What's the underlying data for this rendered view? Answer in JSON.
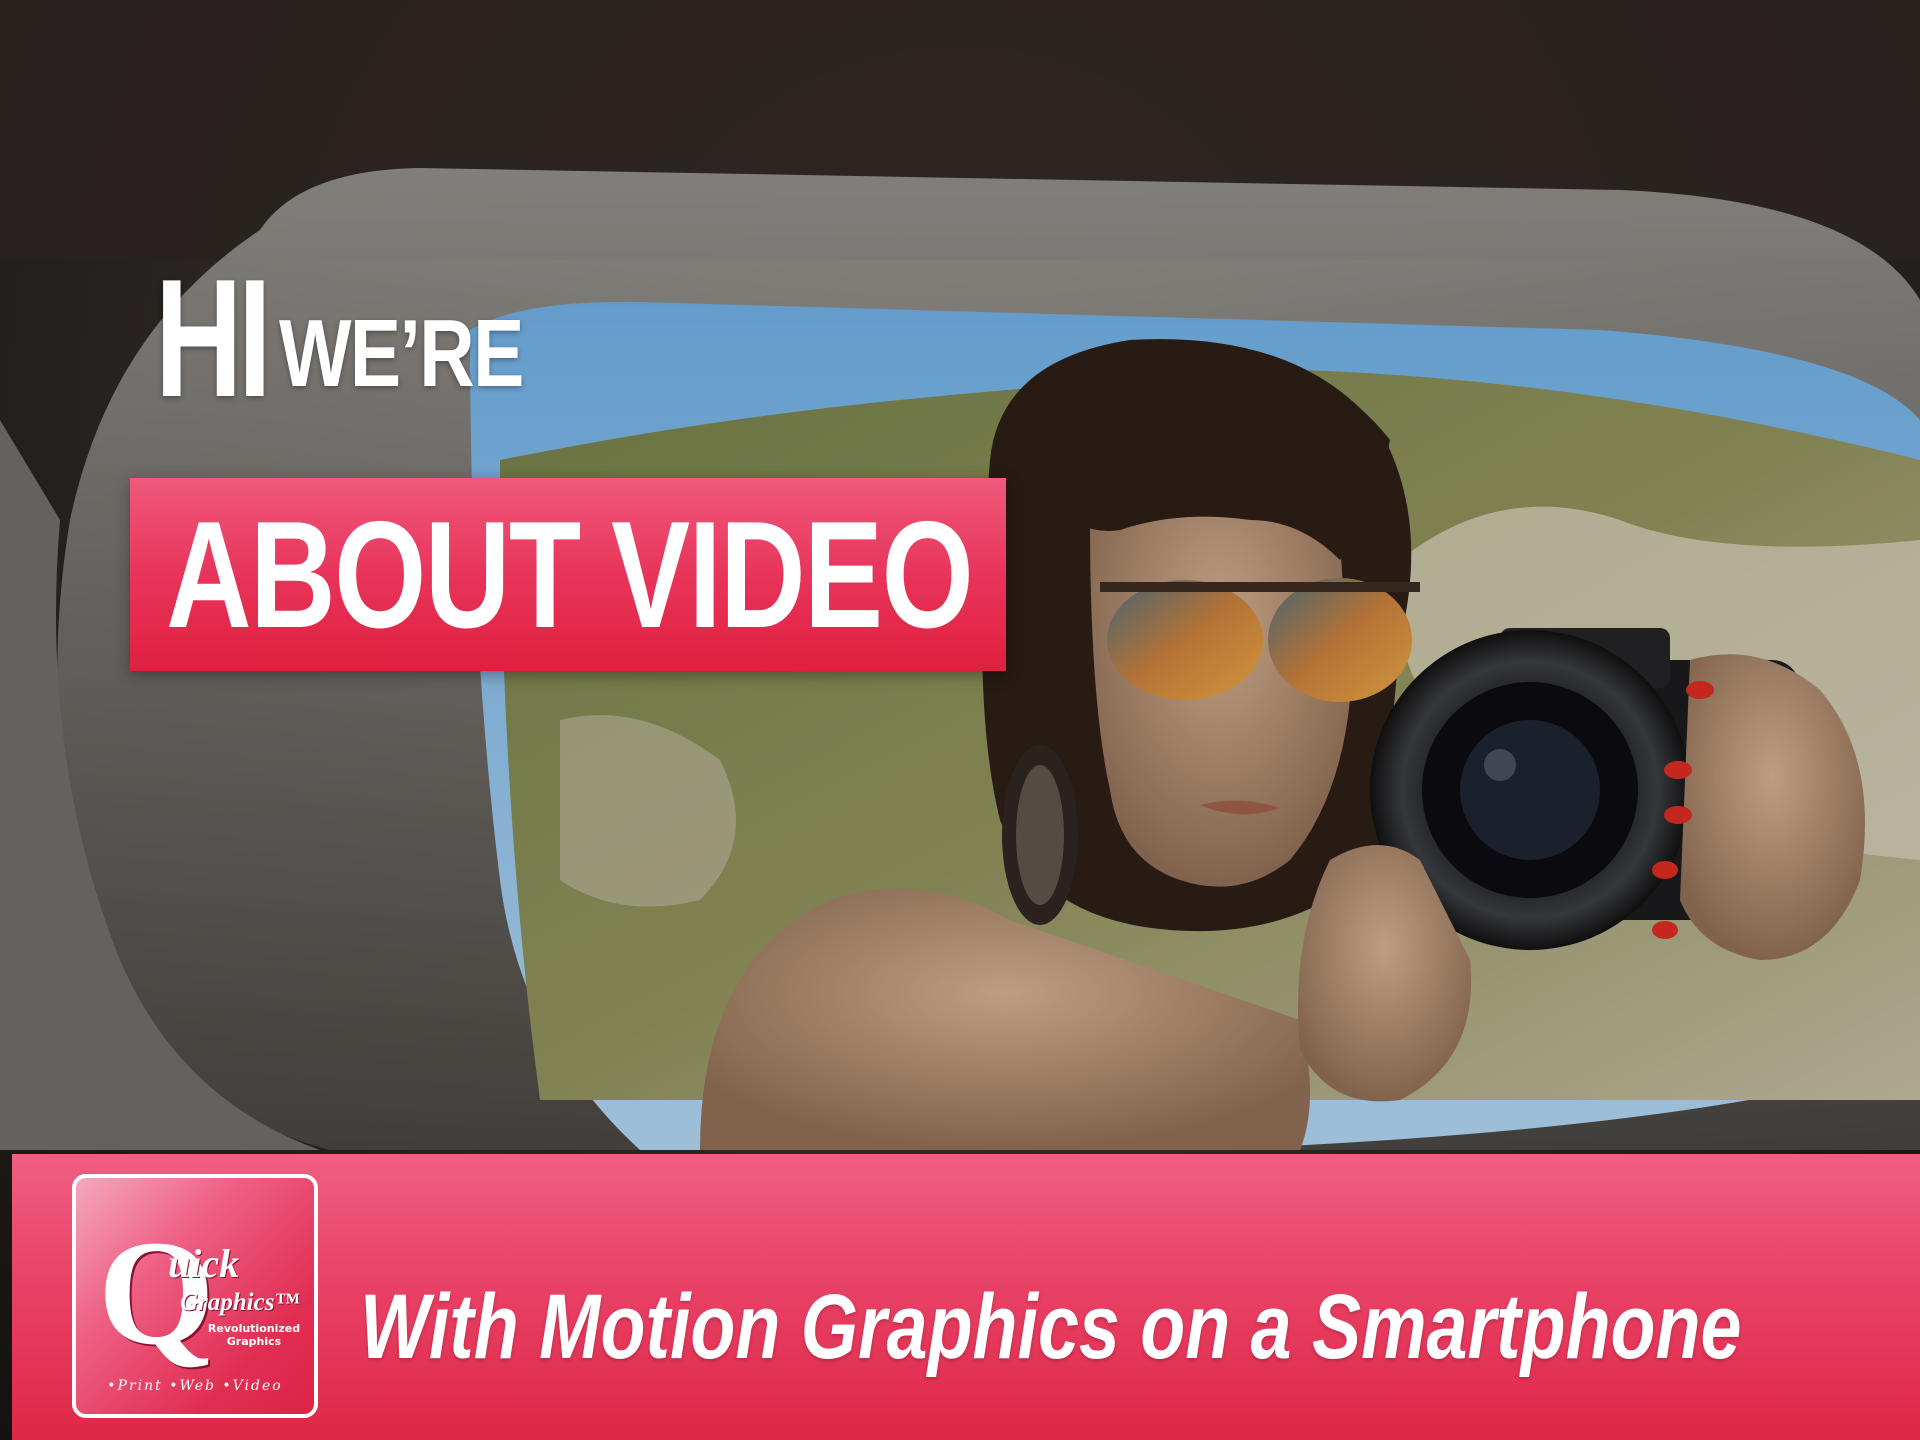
{
  "hero": {
    "hi": "HI",
    "were": "WE’RE",
    "about": "ABOUT VIDEO"
  },
  "banner": {
    "tagline": "With Motion Graphics on a Smartphone",
    "logo": {
      "q": "Q",
      "quick": "uick",
      "graphics": "Graphics™",
      "tagline": "Revolutionized Graphics",
      "services": "•Print •Web •Video"
    }
  },
  "colors": {
    "accent": "#e8345a",
    "text": "#ffffff"
  }
}
